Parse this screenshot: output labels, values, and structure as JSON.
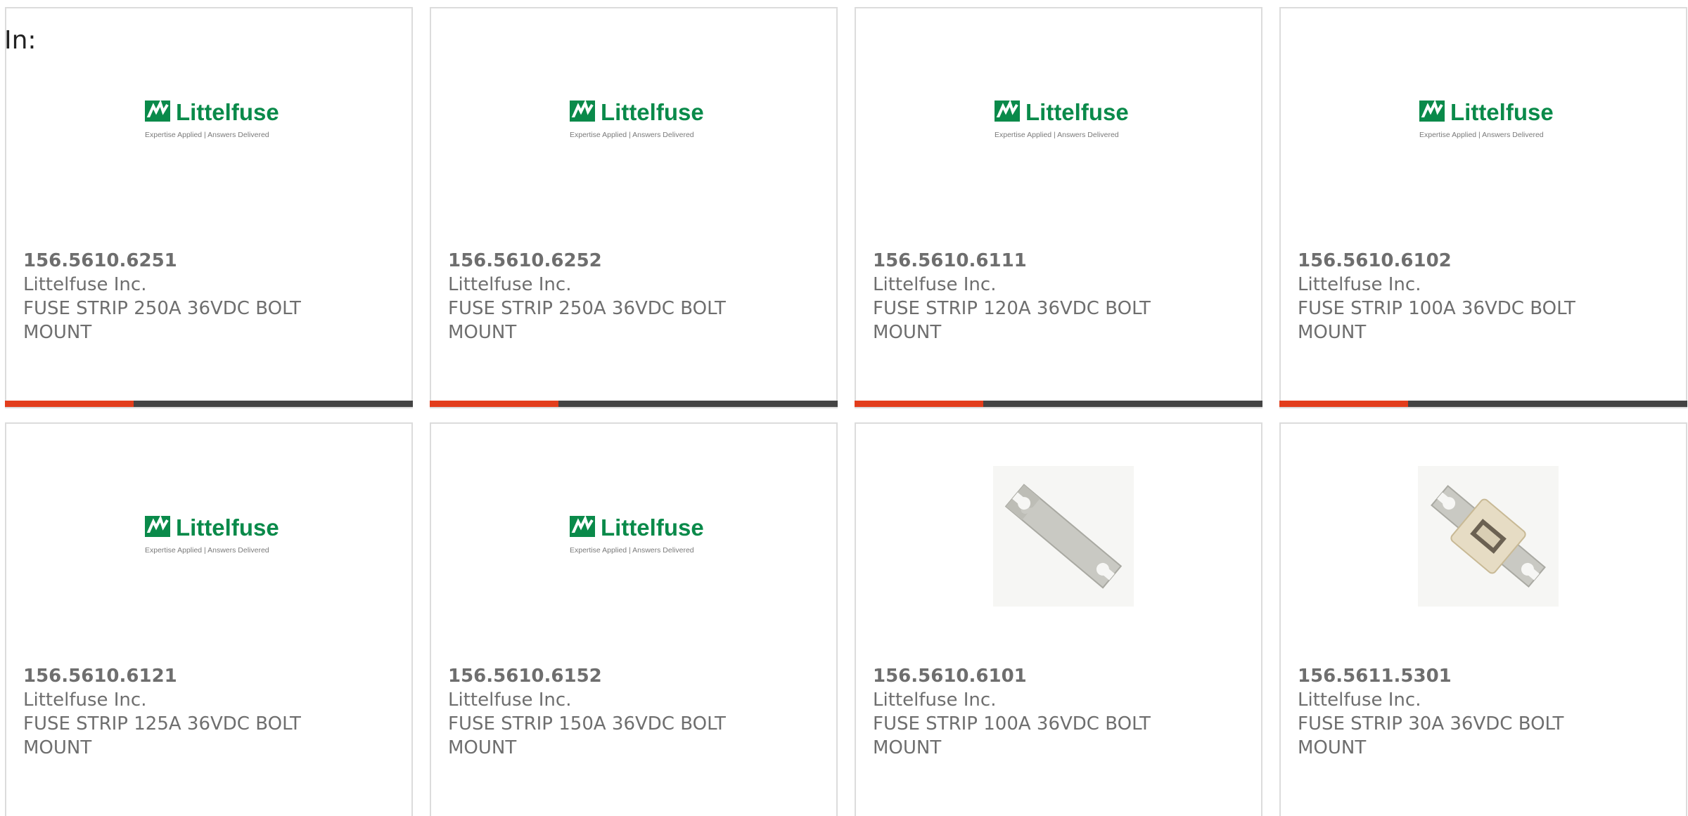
{
  "header": {
    "in_label": "In:"
  },
  "colors": {
    "accent_bar": "#e23d1c",
    "dark_bar": "#444444",
    "brand_green": "#0a8a4a"
  },
  "logo": {
    "name": "Littelfuse",
    "tagline": "Expertise Applied | Answers Delivered"
  },
  "products": [
    {
      "part_number": "156.5610.6251",
      "manufacturer": "Littelfuse Inc.",
      "description": "FUSE STRIP 250A 36VDC BOLT MOUNT",
      "image": "littelfuse-logo"
    },
    {
      "part_number": "156.5610.6252",
      "manufacturer": "Littelfuse Inc.",
      "description": "FUSE STRIP 250A 36VDC BOLT MOUNT",
      "image": "littelfuse-logo"
    },
    {
      "part_number": "156.5610.6111",
      "manufacturer": "Littelfuse Inc.",
      "description": "FUSE STRIP 120A 36VDC BOLT MOUNT",
      "image": "littelfuse-logo"
    },
    {
      "part_number": "156.5610.6102",
      "manufacturer": "Littelfuse Inc.",
      "description": "FUSE STRIP 100A 36VDC BOLT MOUNT",
      "image": "littelfuse-logo"
    },
    {
      "part_number": "156.5610.6121",
      "manufacturer": "Littelfuse Inc.",
      "description": "FUSE STRIP 125A 36VDC BOLT MOUNT",
      "image": "littelfuse-logo"
    },
    {
      "part_number": "156.5610.6152",
      "manufacturer": "Littelfuse Inc.",
      "description": "FUSE STRIP 150A 36VDC BOLT MOUNT",
      "image": "littelfuse-logo"
    },
    {
      "part_number": "156.5610.6101",
      "manufacturer": "Littelfuse Inc.",
      "description": "FUSE STRIP 100A 36VDC BOLT MOUNT",
      "image": "fuse-strip-photo"
    },
    {
      "part_number": "156.5611.5301",
      "manufacturer": "Littelfuse Inc.",
      "description": "FUSE STRIP 30A 36VDC BOLT MOUNT",
      "image": "fuse-strip-housed-photo"
    }
  ]
}
